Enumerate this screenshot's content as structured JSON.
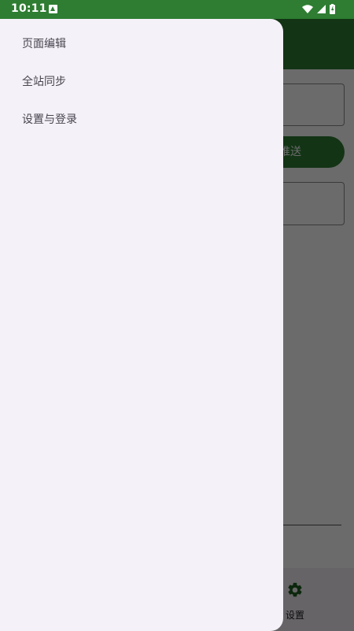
{
  "status_bar": {
    "time": "10:11",
    "notification_icon": "download-a-icon",
    "wifi_icon": "wifi-icon",
    "signal_icon": "cell-signal-icon",
    "battery_icon": "battery-charging-icon"
  },
  "colors": {
    "primary": "#2e7d32",
    "drawer_background": "#f5f1f8",
    "drawer_text": "#49454f",
    "scrim": "rgba(0,0,0,0.58)"
  },
  "main": {
    "push_button_label": "推送"
  },
  "bottom_nav": {
    "settings_label": "设置",
    "settings_icon": "gear-icon"
  },
  "drawer": {
    "items": [
      {
        "label": "页面编辑"
      },
      {
        "label": "全站同步"
      },
      {
        "label": "设置与登录"
      }
    ]
  }
}
